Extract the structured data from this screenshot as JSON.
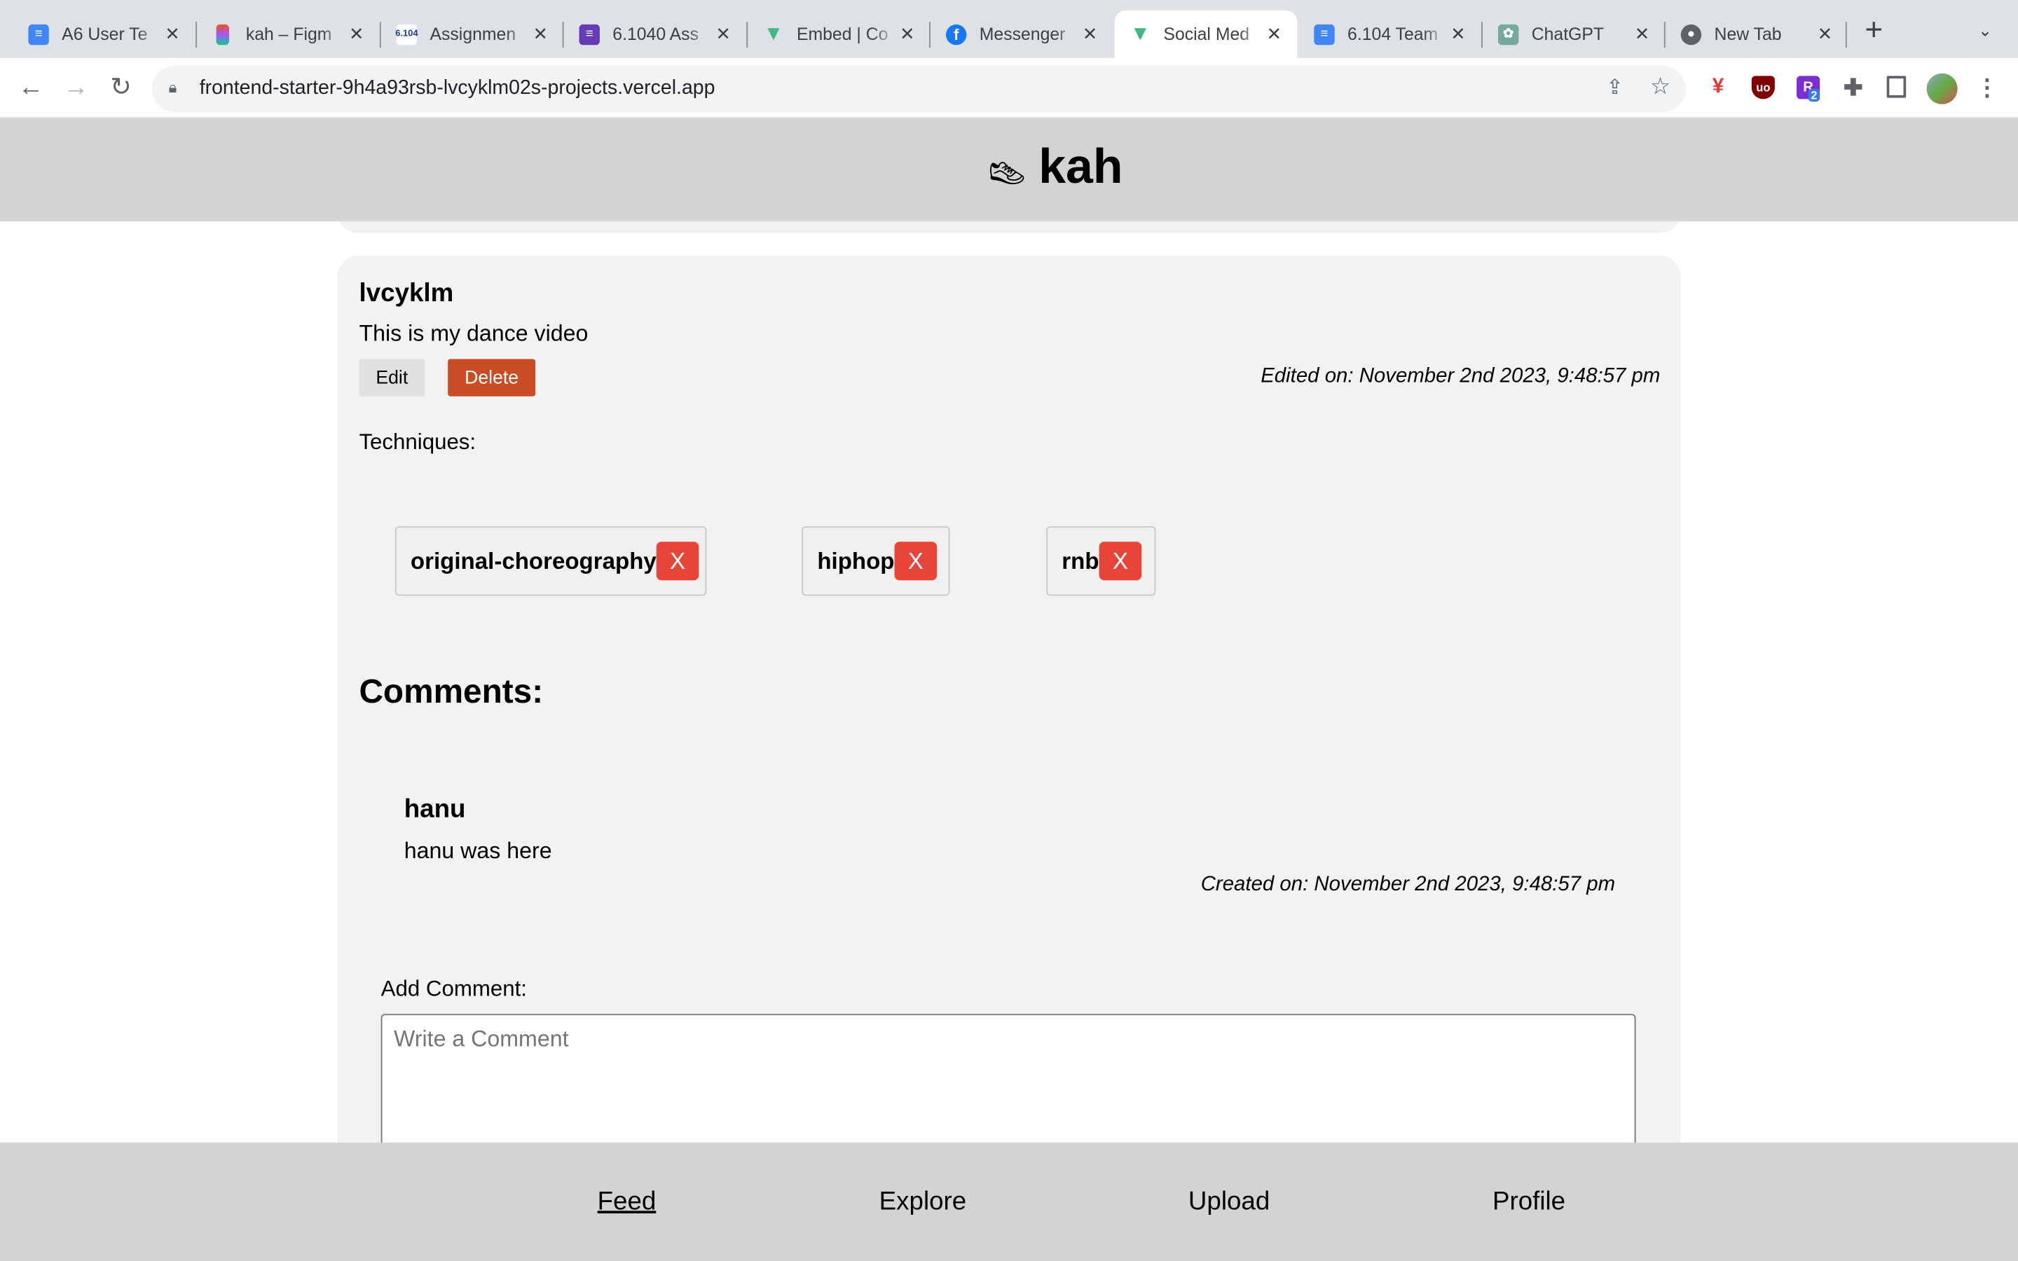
{
  "browser": {
    "tabs": [
      {
        "title": "A6 User Te",
        "icon": "google-docs-icon",
        "color": "#4285f4"
      },
      {
        "title": "kah – Figm",
        "icon": "figma-icon",
        "color": "#a259ff"
      },
      {
        "title": "Assignmen",
        "icon": "6.1040-icon",
        "color": "#ffffff"
      },
      {
        "title": "6.1040 Ass",
        "icon": "google-forms-icon",
        "color": "#673ab7"
      },
      {
        "title": "Embed | Co",
        "icon": "vue-bootstrap-icon",
        "color": "#41b883"
      },
      {
        "title": "Messenger",
        "icon": "facebook-icon",
        "color": "#1877f2"
      },
      {
        "title": "Social Med",
        "icon": "vue-icon",
        "color": "#41b883"
      },
      {
        "title": "6.104 Team",
        "icon": "google-docs-icon",
        "color": "#4285f4"
      },
      {
        "title": "ChatGPT",
        "icon": "chatgpt-icon",
        "color": "#74aa9c"
      },
      {
        "title": "New Tab",
        "icon": "chrome-icon",
        "color": "#5f6368"
      }
    ],
    "active_tab": 6,
    "url": "frontend-starter-9h4a93rsb-lvcyklm02s-projects.vercel.app",
    "extension_badge": "2"
  },
  "header": {
    "title": "kah",
    "icon": "shoe-icon"
  },
  "post": {
    "author": "lvcyklm",
    "content": "This is my dance video",
    "edit_label": "Edit",
    "delete_label": "Delete",
    "edited": "Edited on: November 2nd 2023, 9:48:57 pm",
    "techniques_label": "Techniques:",
    "tags": [
      {
        "label": "original-choreography",
        "remove": "X"
      },
      {
        "label": "hiphop",
        "remove": "X"
      },
      {
        "label": "rnb",
        "remove": "X"
      }
    ]
  },
  "comments": {
    "heading": "Comments:",
    "items": [
      {
        "author": "hanu",
        "content": "hanu was here",
        "created": "Created on: November 2nd 2023, 9:48:57 pm"
      }
    ],
    "add_label": "Add Comment:",
    "placeholder": "Write a Comment"
  },
  "footer": {
    "links": [
      "Feed",
      "Explore",
      "Upload",
      "Profile"
    ],
    "active": "Feed"
  },
  "colors": {
    "delete": "#c94c24",
    "tag_remove": "#e8453a",
    "header_bg": "#d3d3d3"
  }
}
